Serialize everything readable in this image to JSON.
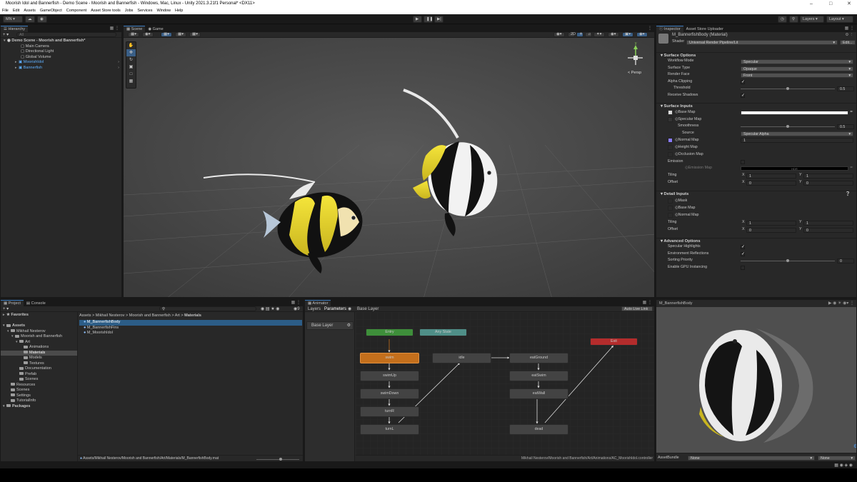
{
  "window": {
    "title": "Moorish Idol and Bannerfish - Demo Scene - Moorish and Bannerfish - Windows, Mac, Linux - Unity 2021.3.21f1 Personal* <DX11>"
  },
  "menu": [
    "File",
    "Edit",
    "Assets",
    "GameObject",
    "Component",
    "Asset Store tools",
    "Jobs",
    "Services",
    "Window",
    "Help"
  ],
  "toolbar": {
    "account": "MN ▾",
    "layers": "Layers",
    "layout": "Layout"
  },
  "hierarchy": {
    "tab": "Hierarchy",
    "search_placeholder": "All",
    "scene": "Demo Scene - Moorish and Bannerfish*",
    "items": [
      "Main Camera",
      "Directional Light",
      "Global Volume",
      "MoorishIdol",
      "Bannerfish"
    ]
  },
  "scene_view": {
    "tabs": [
      "Scene",
      "Game"
    ],
    "persp_label": "< Persp"
  },
  "inspector": {
    "tabs": [
      "Inspector",
      "Asset Store Uploader"
    ],
    "material_name": "M_BannerfishBody (Material)",
    "shader_label": "Shader",
    "shader_value": "Universal Render Pipeline/Lit",
    "edit_label": "Edit...",
    "surface_options": {
      "header": "Surface Options",
      "rows": [
        {
          "label": "Workflow Mode",
          "value": "Specular"
        },
        {
          "label": "Surface Type",
          "value": "Opaque"
        },
        {
          "label": "Render Face",
          "value": "Front"
        }
      ],
      "alpha_clipping": "Alpha Clipping",
      "threshold": "Threshold",
      "threshold_value": "0.5",
      "threshold_fraction": 0.5,
      "receive_shadows": "Receive Shadows"
    },
    "surface_inputs": {
      "header": "Surface Inputs",
      "base_map": "Base Map",
      "specular_map": "Specular Map",
      "smoothness": "Smoothness",
      "smoothness_value": "0.5",
      "smoothness_fraction": 0.5,
      "source": "Source",
      "source_value": "Specular Alpha",
      "normal_map": "Normal Map",
      "normal_value": "1",
      "height_map": "Height Map",
      "occlusion_map": "Occlusion Map",
      "emission": "Emission",
      "emission_map": "Emission Map",
      "emission_hdr": "HDR",
      "tiling": "Tiling",
      "offset": "Offset",
      "tiling_x": "1",
      "tiling_y": "1",
      "offset_x": "0",
      "offset_y": "0",
      "axis_x": "X",
      "axis_y": "Y"
    },
    "detail_inputs": {
      "header": "Detail Inputs",
      "mask": "Mask",
      "base_map": "Base Map",
      "normal_map": "Normal Map",
      "tiling": "Tiling",
      "offset": "Offset",
      "tiling_x": "1",
      "tiling_y": "1",
      "offset_x": "0",
      "offset_y": "0"
    },
    "advanced_options": {
      "header": "Advanced Options",
      "specular_highlights": "Specular Highlights",
      "env_reflections": "Environment Reflections",
      "sorting_priority": "Sorting Priority",
      "sorting_value": "0",
      "sorting_fraction": 0.5,
      "gpu_instancing": "Enable GPU Instancing"
    }
  },
  "preview": {
    "title": "M_BannerfishBody",
    "assetbundle_label": "AssetBundle",
    "assetbundle_value": "None",
    "variant_value": "None"
  },
  "project": {
    "tabs": [
      "Project",
      "Console"
    ],
    "search_count": "9",
    "favorites": "Favorites",
    "tree": [
      {
        "label": "Assets",
        "indent": 0,
        "bold": true
      },
      {
        "label": "Mikhail Nesterov",
        "indent": 1
      },
      {
        "label": "Moorish and Bannerfish",
        "indent": 2
      },
      {
        "label": "Art",
        "indent": 3
      },
      {
        "label": "Animations",
        "indent": 4
      },
      {
        "label": "Materials",
        "indent": 4,
        "selected": true
      },
      {
        "label": "Models",
        "indent": 4
      },
      {
        "label": "Textures",
        "indent": 4
      },
      {
        "label": "Documentation",
        "indent": 3
      },
      {
        "label": "Prefab",
        "indent": 3
      },
      {
        "label": "Scenes",
        "indent": 3
      },
      {
        "label": "Resources",
        "indent": 1
      },
      {
        "label": "Scenes",
        "indent": 1
      },
      {
        "label": "Settings",
        "indent": 1
      },
      {
        "label": "TutorialInfo",
        "indent": 1
      },
      {
        "label": "Packages",
        "indent": 0,
        "bold": true
      }
    ],
    "breadcrumb": [
      "Assets",
      "Mikhail Nesterov",
      "Moorish and Bannerfish",
      "Art",
      "Materials"
    ],
    "files": [
      "M_BannerfishBody",
      "M_BannerfishFins",
      "M_MoorishIdol"
    ],
    "status_path": "Assets/Mikhail Nesterov/Moorish and Bannerfish/Art/Materials/M_BannerfishBody.mat"
  },
  "animator": {
    "tab": "Animator",
    "subtabs": [
      "Layers",
      "Parameters"
    ],
    "breadcrumb": "Base Layer",
    "auto_live_link": "Auto Live Link",
    "layer_item": "Base Layer",
    "states": {
      "entry": "Entry",
      "any": "Any State",
      "exit": "Exit",
      "swim": "swim",
      "swimUp": "swimUp",
      "swimDown": "swimDown",
      "turnR": "turnR",
      "turnL": "turnL",
      "idle": "idle",
      "eatGround": "eatGround",
      "eatSwim": "eatSwim",
      "eatWall": "eatWall",
      "dead": "dead"
    },
    "status_path": "Mikhail Nesterov/Moorish and Bannerfish/Art/Animations/AC_MoorishIdol.controller"
  },
  "colors": {
    "entry": "#3e8f3a",
    "any": "#4f8f88",
    "exit": "#b42c2c",
    "default_state": "#c46f1c",
    "selection": "#2c5d87",
    "accent": "#5fb0ff"
  }
}
